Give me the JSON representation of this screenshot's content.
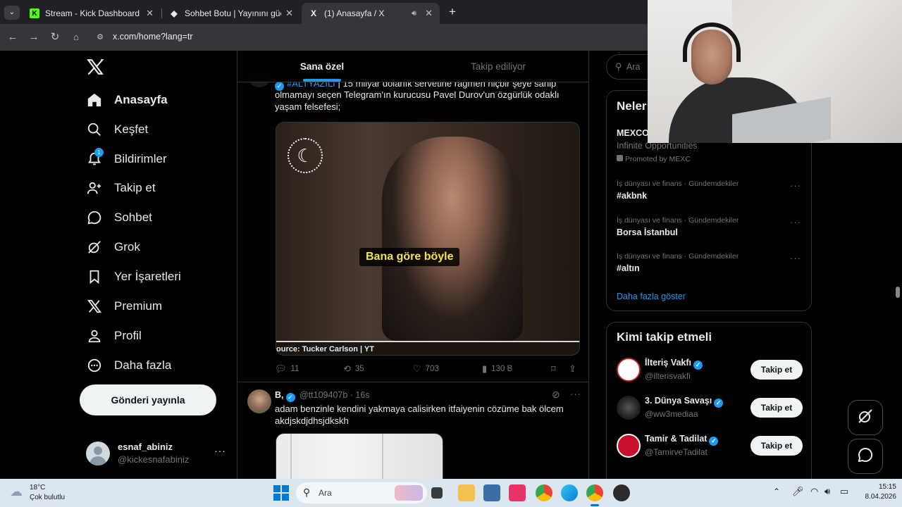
{
  "browser": {
    "tabs": [
      {
        "title": "Stream - Kick Dashboard",
        "favicon": "K"
      },
      {
        "title": "Sohbet Botu | Yayınını güçlendir",
        "favicon": "◆"
      },
      {
        "title": "(1) Anasayfa / X",
        "favicon": "X"
      }
    ],
    "url": "x.com/home?lang=tr"
  },
  "nav": {
    "items": [
      "Anasayfa",
      "Keşfet",
      "Bildirimler",
      "Takip et",
      "Sohbet",
      "Grok",
      "Yer İşaretleri",
      "Premium",
      "Profil",
      "Daha fazla"
    ],
    "notif_badge": "1",
    "post_button": "Gönderi yayınla",
    "account_name": "esnaf_abiniz",
    "account_handle": "@kickesnafabiniz"
  },
  "timeline": {
    "tabs": [
      "Sana özel",
      "Takip ediliyor"
    ],
    "tweet1": {
      "text_line0_tag": "#ALTYAZILI",
      "text_line0_rest": "15 milyar dolarlık servetine rağmen hiçbir şeye sahip",
      "text_line1": "olmamayı seçen Telegram'ın kurucusu Pavel Durov'un özgürlük odaklı",
      "text_line2": "yaşam felsefesi;",
      "video_caption": "Bana göre böyle",
      "video_source": "ource: Tucker Carlson | YT",
      "replies": "11",
      "reposts": "35",
      "likes": "703",
      "views": "130 B"
    },
    "tweet2": {
      "name": "B,",
      "handle": "@tt109407b",
      "time": "· 16s",
      "line1": "adam benzinle kendini yakmaya calisirken itfaiyenin cözüme bak ölcem",
      "line2": "akdjskdjdhsjdkskh"
    }
  },
  "right": {
    "search_placeholder": "Ara",
    "whats_happening_title": "Neler",
    "promo": {
      "title": "MEXCO",
      "subtitle": "Infinite Opportunities",
      "promoted": "Promoted by MEXC"
    },
    "trends": [
      {
        "meta": "İş dünyası ve finans · Gündemdekiler",
        "name": "#akbnk"
      },
      {
        "meta": "İş dünyası ve finans · Gündemdekiler",
        "name": "Borsa İstanbul"
      },
      {
        "meta": "İş dünyası ve finans · Gündemdekiler",
        "name": "#altın"
      }
    ],
    "show_more": "Daha fazla göster",
    "who_to_follow_title": "Kimi takip etmeli",
    "follow": [
      {
        "name": "İlteriş Vakfı",
        "handle": "@ilterisvakfi"
      },
      {
        "name": "3. Dünya Savaşı",
        "handle": "@ww3mediaa"
      },
      {
        "name": "Tamir & Tadilat",
        "handle": "@TamirveTadilat"
      }
    ],
    "follow_label": "Takip et"
  },
  "taskbar": {
    "temp": "18°C",
    "weather": "Çok bulutlu",
    "search": "Ara",
    "time": "15:15",
    "date": "8.04.2026"
  }
}
